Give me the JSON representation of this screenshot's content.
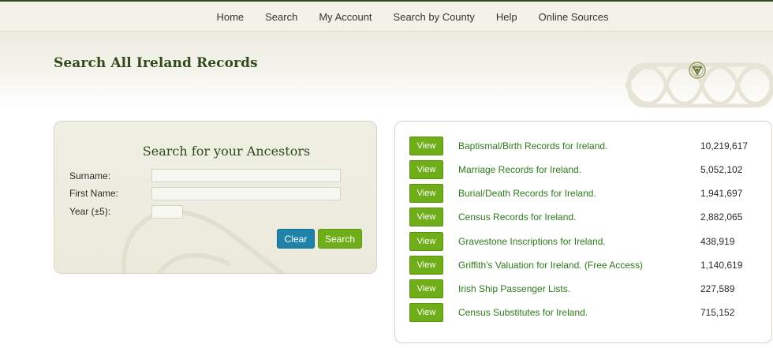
{
  "nav": {
    "items": [
      {
        "label": "Home"
      },
      {
        "label": "Search"
      },
      {
        "label": "My Account"
      },
      {
        "label": "Search by County"
      },
      {
        "label": "Help"
      },
      {
        "label": "Online Sources"
      }
    ]
  },
  "header": {
    "title": "Search All Ireland Records"
  },
  "search_form": {
    "title": "Search for your Ancestors",
    "surname_label": "Surname:",
    "surname_value": "",
    "first_name_label": "First Name:",
    "first_name_value": "",
    "year_label": "Year (±5):",
    "year_value": "",
    "clear_label": "Clear",
    "search_label": "Search"
  },
  "records": {
    "view_label": "View",
    "items": [
      {
        "name": "Baptismal/Birth Records for Ireland.",
        "count": "10,219,617"
      },
      {
        "name": "Marriage Records for Ireland.",
        "count": "5,052,102"
      },
      {
        "name": "Burial/Death Records for Ireland.",
        "count": "1,941,697"
      },
      {
        "name": "Census Records for Ireland.",
        "count": "2,882,065"
      },
      {
        "name": "Gravestone Inscriptions for Ireland.",
        "count": "438,919"
      },
      {
        "name": "Griffith's Valuation for Ireland. (Free Access)",
        "count": "1,140,619"
      },
      {
        "name": "Irish Ship Passenger Lists.",
        "count": "227,589"
      },
      {
        "name": "Census Substitutes for Ireland.",
        "count": "715,152"
      }
    ]
  },
  "colors": {
    "brand_dark_green": "#2f4a1c",
    "button_green": "#6fae18",
    "button_blue": "#1f82a8",
    "link_green": "#2e7a1b"
  },
  "icons": {
    "emblem": "celtic-triangle-emblem-icon",
    "knot": "celtic-knot-decoration"
  }
}
